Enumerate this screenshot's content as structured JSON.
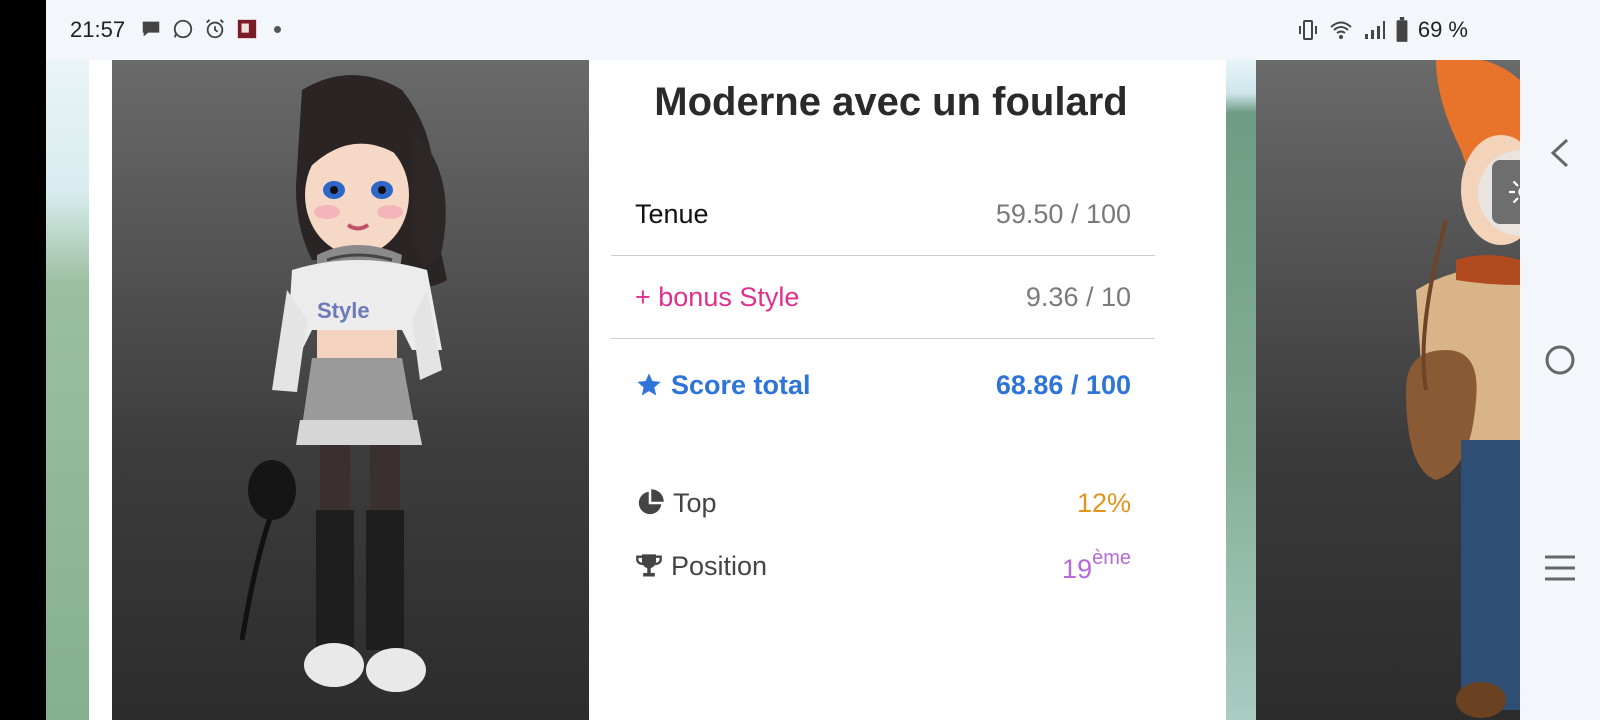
{
  "status_bar": {
    "time": "21:57",
    "left_icons": [
      "chat-bubble-icon",
      "whatsapp-icon",
      "alarm-icon",
      "app-thumbnail-icon"
    ],
    "right_icons": [
      "vibrate-icon",
      "wifi-icon",
      "signal-icon",
      "battery-icon"
    ],
    "battery": "69 %"
  },
  "outfit": {
    "title": "Moderne avec un foulard",
    "tenue_label": "Tenue",
    "tenue_value": "59.50 / 100",
    "bonus_label": "+ bonus Style",
    "bonus_value": "9.36 / 10",
    "score_label": "Score total",
    "score_value": "68.86 / 100",
    "top_label": "Top",
    "top_value": "12%",
    "position_label": "Position",
    "position_value": "19",
    "position_suffix": "ème"
  },
  "colors": {
    "bonus": "#e0308e",
    "score": "#2f74d8",
    "top": "#e4941b",
    "position": "#b46ad9"
  },
  "navigation": [
    "back-icon",
    "home-icon",
    "recents-icon"
  ]
}
